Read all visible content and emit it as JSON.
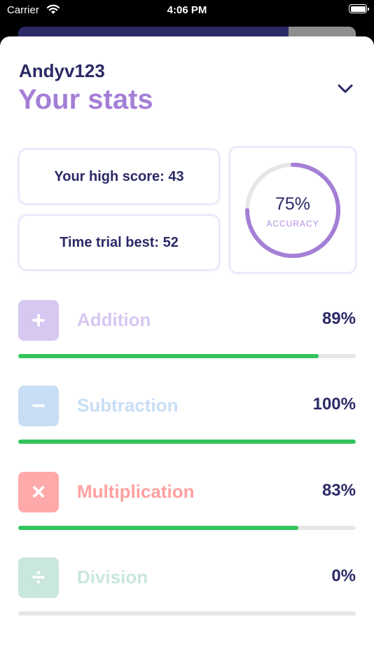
{
  "status_bar": {
    "carrier": "Carrier",
    "time": "4:06 PM"
  },
  "header": {
    "username": "Andyv123",
    "title": "Your stats"
  },
  "stats": {
    "high_score": "Your high score: 43",
    "time_trial": "Time trial best: 52",
    "accuracy_value": "75%",
    "accuracy_label": "ACCURACY",
    "accuracy_fraction": 0.75
  },
  "operations": [
    {
      "symbol": "+",
      "name": "Addition",
      "percent": "89%",
      "progress": 0.89,
      "color": "#d7c8f1",
      "text_color": "#d7c8f1",
      "icon": "plus-icon"
    },
    {
      "symbol": "−",
      "name": "Subtraction",
      "percent": "100%",
      "progress": 1.0,
      "color": "#c8def4",
      "text_color": "#c8def4",
      "icon": "minus-icon"
    },
    {
      "symbol": "×",
      "name": "Multiplication",
      "percent": "83%",
      "progress": 0.83,
      "color": "#ffaaaa",
      "text_color": "#ffa0a0",
      "icon": "multiply-icon"
    },
    {
      "symbol": "÷",
      "name": "Division",
      "percent": "0%",
      "progress": 0.0,
      "color": "#c9e6df",
      "text_color": "#c9e6df",
      "icon": "divide-icon"
    }
  ],
  "colors": {
    "navy": "#2b2a66",
    "purple": "#a47fd6",
    "progress_green": "#33c45c",
    "ring_track": "#e6e6e6"
  }
}
